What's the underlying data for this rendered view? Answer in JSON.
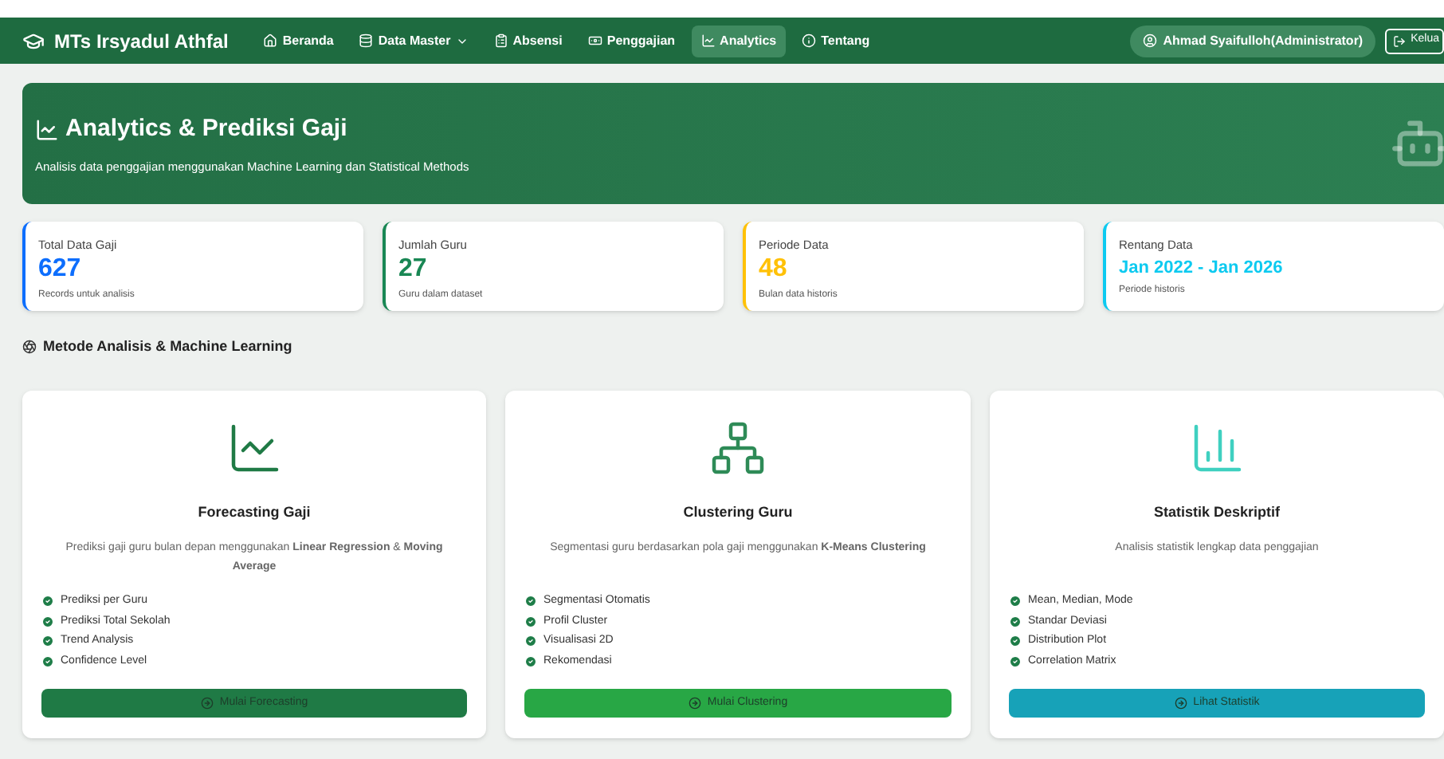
{
  "navbar": {
    "brand": "MTs Irsyadul Athfal",
    "items": [
      {
        "label": "Beranda",
        "kind": "home",
        "dropdown": false,
        "selected": false
      },
      {
        "label": "Data Master",
        "kind": "database",
        "dropdown": true,
        "selected": false
      },
      {
        "label": "Absensi",
        "kind": "clipboard",
        "dropdown": false,
        "selected": false
      },
      {
        "label": "Penggajian",
        "kind": "money",
        "dropdown": false,
        "selected": false
      },
      {
        "label": "Analytics",
        "kind": "chart",
        "dropdown": false,
        "selected": true
      },
      {
        "label": "Tentang",
        "kind": "info",
        "dropdown": false,
        "selected": false
      }
    ],
    "user": "Ahmad Syaifulloh(Administrator)",
    "logout": "Kelua"
  },
  "hero": {
    "title": "Analytics & Prediksi Gaji",
    "subtitle": "Analisis data penggajian menggunakan Machine Learning dan Statistical Methods"
  },
  "stats": [
    {
      "label": "Total Data Gaji",
      "value": "627",
      "caption": "Records untuk analisis",
      "color": "#0d6efd"
    },
    {
      "label": "Jumlah Guru",
      "value": "27",
      "caption": "Guru dalam dataset",
      "color": "#198754"
    },
    {
      "label": "Periode Data",
      "value": "48",
      "caption": "Bulan data historis",
      "color": "#ffc107"
    },
    {
      "label": "Rentang Data",
      "value": "Jan 2022 - Jan 2026",
      "caption": "Periode historis",
      "color": "#0dcaf0"
    }
  ],
  "section_title": "Metode Analisis & Machine Learning",
  "methods": [
    {
      "kind": "forecast",
      "title": "Forecasting Gaji",
      "description": "Prediksi gaji guru bulan depan menggunakan **Linear Regression** & **Moving Average**",
      "features": [
        "Prediksi per Guru",
        "Prediksi Total Sekolah",
        "Trend Analysis",
        "Confidence Level"
      ],
      "button": "Mulai Forecasting",
      "color": "#1f7a45"
    },
    {
      "kind": "cluster",
      "title": "Clustering Guru",
      "description": "Segmentasi guru berdasarkan pola gaji menggunakan **K-Means Clustering**",
      "features": [
        "Segmentasi Otomatis",
        "Profil Cluster",
        "Visualisasi 2D",
        "Rekomendasi"
      ],
      "button": "Mulai Clustering",
      "color": "#28a745"
    },
    {
      "kind": "stats",
      "title": "Statistik Deskriptif",
      "description": "Analisis statistik lengkap data penggajian",
      "features": [
        "Mean, Median, Mode",
        "Standar Deviasi",
        "Distribution Plot",
        "Correlation Matrix"
      ],
      "button": "Lihat Statistik",
      "color": "#17a2b8"
    }
  ]
}
